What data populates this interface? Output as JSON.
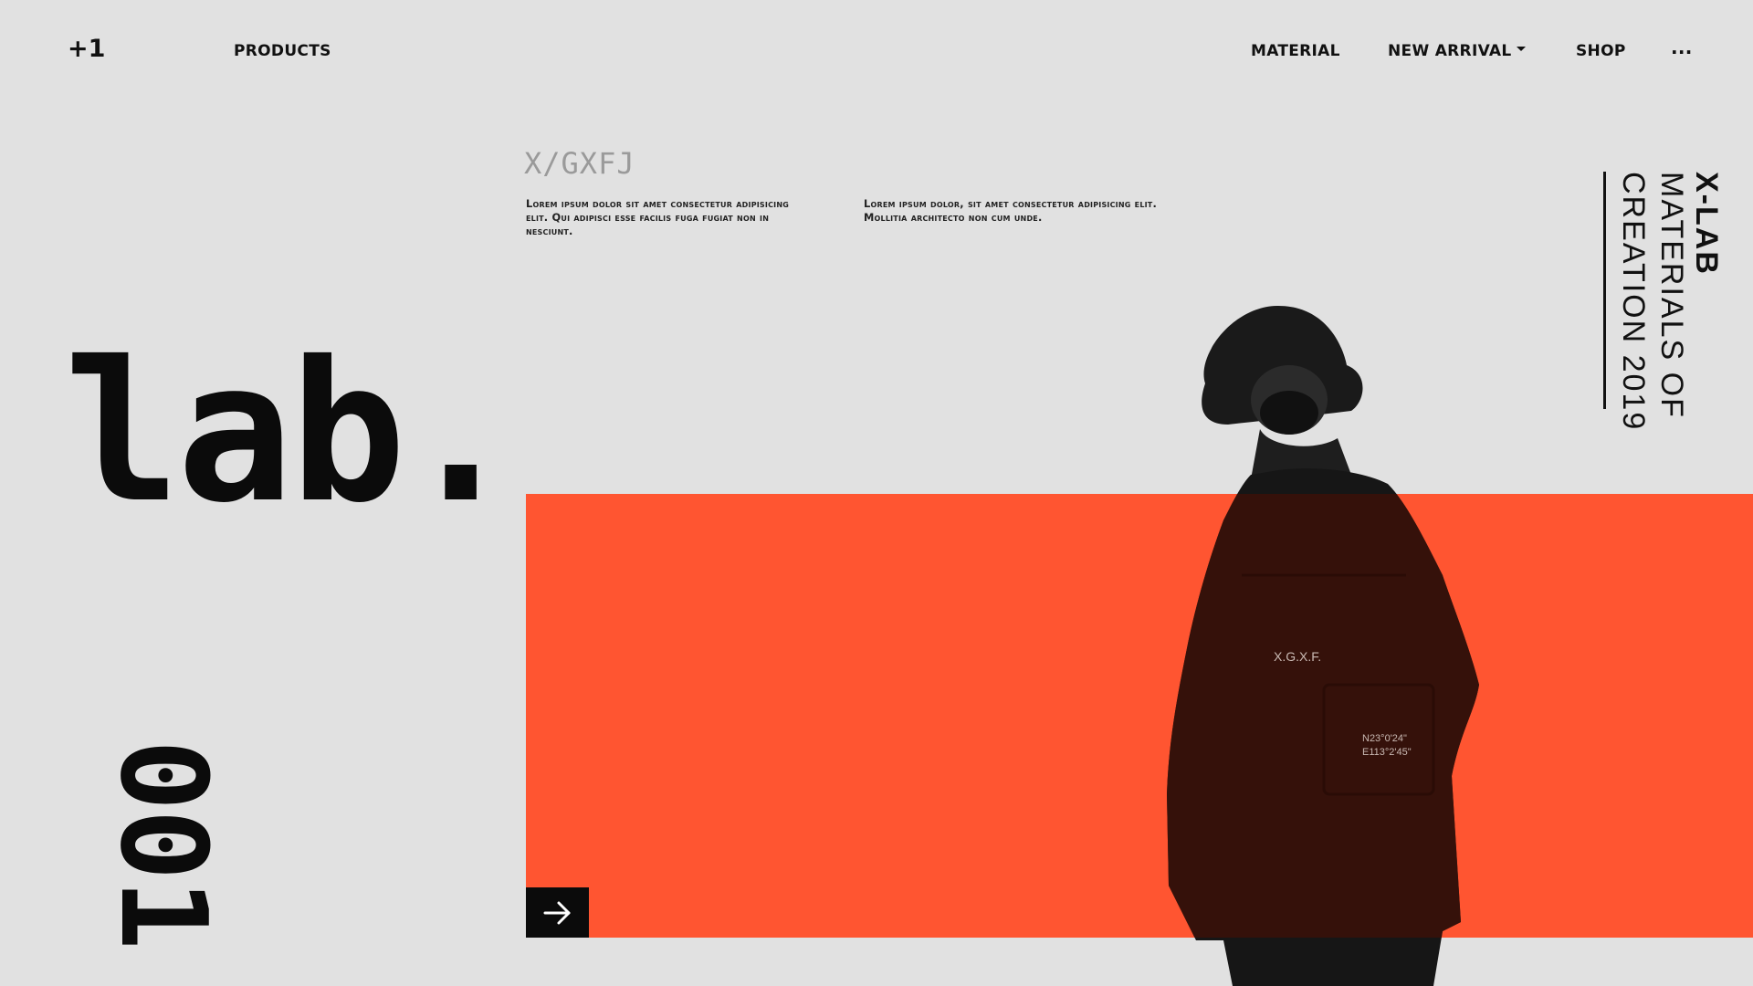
{
  "nav": {
    "brand": "+1",
    "products": "PRODUCTS",
    "material": "MATERIAL",
    "new_arrival": "NEW ARRIVAL",
    "shop": "SHOP",
    "more": "..."
  },
  "hero": {
    "logo_text": "X/GXFJ",
    "blurb_1": "Lorem ipsum dolor sit amet consectetur adipisicing elit. Qui adipisci esse facilis fuga fugiat non in nesciunt.",
    "blurb_2": "Lorem ipsum dolor, sit amet consectetur adipisicing elit. Mollitia architecto non cum unde.",
    "big_word": "lab.",
    "number": "001",
    "vertical_lines": [
      "X-LAB",
      "MATERIALS OF",
      "CREATION 2019"
    ]
  },
  "jacket": {
    "brand_print": "X.G.X.F.",
    "coord_1": "N23°0'24\"",
    "coord_2": "E113°2'45\""
  },
  "colors": {
    "background": "#e1e1e1",
    "accent": "#ff5531",
    "ink": "#0b0b0b"
  },
  "icons": {
    "arrow": "arrow-right-icon",
    "caret": "caret-down-icon"
  }
}
